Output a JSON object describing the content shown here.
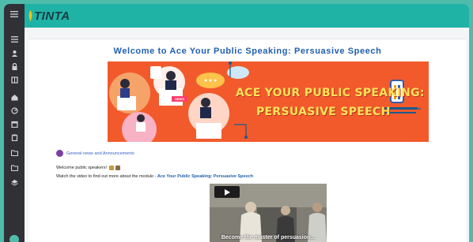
{
  "app": {
    "logo_text": "TINTA"
  },
  "sidebar": {
    "icons": [
      "menu-icon",
      "list-icon",
      "user-icon",
      "lock-icon",
      "book-icon",
      "home-icon",
      "dashboard-icon",
      "calendar-icon",
      "clipboard-icon",
      "folder-icon",
      "folder-icon",
      "layers-icon"
    ]
  },
  "course": {
    "title": "Welcome to Ace Your Public Speaking: Persuasive Speech",
    "banner": {
      "line1": "ACE YOUR PUBLIC SPEAKING:",
      "line2": "PERSUASIVE SPEECH",
      "badge": "NEWS",
      "background": "#f25a2c"
    }
  },
  "feed": {
    "announcements_label": "General news and Announcements"
  },
  "intro": {
    "welcome_text": "Welcome public speakers!",
    "watch_prefix": "Watch the video to find out more about the module - ",
    "watch_link": "Ace Your Public Speaking: Persuasive Speech"
  },
  "video": {
    "caption": "Become the master of persuasion..."
  },
  "colors": {
    "topbar": "#1fb3a5",
    "sidebar": "#2f3136",
    "title": "#1f5fb0"
  }
}
